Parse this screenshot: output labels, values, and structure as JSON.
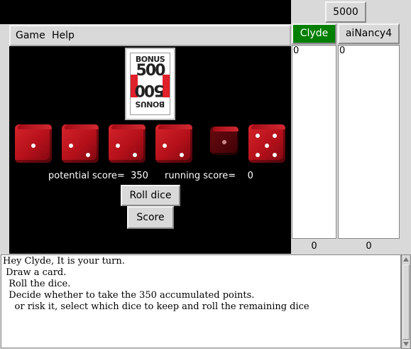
{
  "menu": {
    "game": "Game",
    "help": "Help"
  },
  "card": {
    "top_word": "BONUS",
    "value": "500",
    "colors": {
      "band": "#e0202a"
    }
  },
  "dice": [
    {
      "value": 1,
      "held": false
    },
    {
      "value": 2,
      "held": false
    },
    {
      "value": 2,
      "held": false
    },
    {
      "value": 2,
      "held": false
    },
    {
      "value": 1,
      "held": true
    },
    {
      "value": 5,
      "held": false
    }
  ],
  "scores": {
    "potential_label": "potential score=",
    "potential_value": "350",
    "running_label": "running score=",
    "running_value": "0"
  },
  "buttons": {
    "roll": "Roll dice",
    "score": "Score"
  },
  "target": "5000",
  "players": [
    {
      "name": "Clyde",
      "active": true,
      "history": "0",
      "total": "0",
      "color": "#007f00"
    },
    {
      "name": "aiNancy4",
      "active": false,
      "history": "0",
      "total": "0"
    }
  ],
  "message": "Hey Clyde, It is your turn.\n Draw a card.\n  Roll the dice.\n  Decide whether to take the 350 accumulated points.\n    or risk it, select which dice to keep and roll the remaining dice"
}
